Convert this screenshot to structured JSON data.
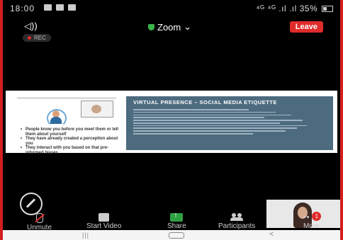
{
  "status_bar": {
    "time": "18:00",
    "right_text": "35%",
    "signal_text": "⁴ᴳ ⁴ᴳ .ıl .ıl"
  },
  "top_bar": {
    "app_title": "Zoom",
    "leave_label": "Leave",
    "rec_label": "REC"
  },
  "slide": {
    "right_title": "VIRTUAL PRESENCE – SOCIAL MEDIA ETIQUETTE",
    "bullets": [
      "People know you before you meet them or tell them about yourself",
      "They have already created a perception about you",
      "They interact with you based on that pre-informed biases"
    ]
  },
  "toolbar": {
    "unmute_label": "Unmute",
    "start_video_label": "Start Video",
    "share_label": "Share",
    "participants_label": "Participants",
    "more_label": "More",
    "more_badge": "1"
  },
  "colors": {
    "leave_red": "#e02b2b",
    "share_green": "#2ea043",
    "slide_panel": "#4d6b7f"
  }
}
